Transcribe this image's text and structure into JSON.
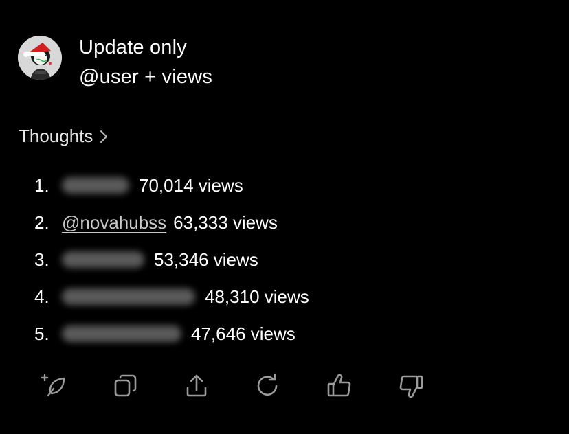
{
  "message": {
    "line1": "Update only",
    "line2": "@user + views"
  },
  "thoughts": {
    "label": "Thoughts"
  },
  "ranking": [
    {
      "rank": "1.",
      "handle": "",
      "blurred": true,
      "views": "70,014 views"
    },
    {
      "rank": "2.",
      "handle": "@novahubss",
      "blurred": false,
      "views": "63,333 views"
    },
    {
      "rank": "3.",
      "handle": "",
      "blurred": true,
      "views": "53,346 views"
    },
    {
      "rank": "4.",
      "handle": "",
      "blurred": true,
      "views": "48,310 views"
    },
    {
      "rank": "5.",
      "handle": "",
      "blurred": true,
      "views": "47,646 views"
    }
  ],
  "actions": [
    {
      "icon": "sparkle-leaf-icon"
    },
    {
      "icon": "copy-icon"
    },
    {
      "icon": "share-icon"
    },
    {
      "icon": "regenerate-icon"
    },
    {
      "icon": "thumbs-up-icon"
    },
    {
      "icon": "thumbs-down-icon"
    }
  ],
  "colors": {
    "background": "#000000",
    "text": "#ffffff",
    "muted": "#c9c9c9",
    "icon": "#9a9a9a"
  }
}
